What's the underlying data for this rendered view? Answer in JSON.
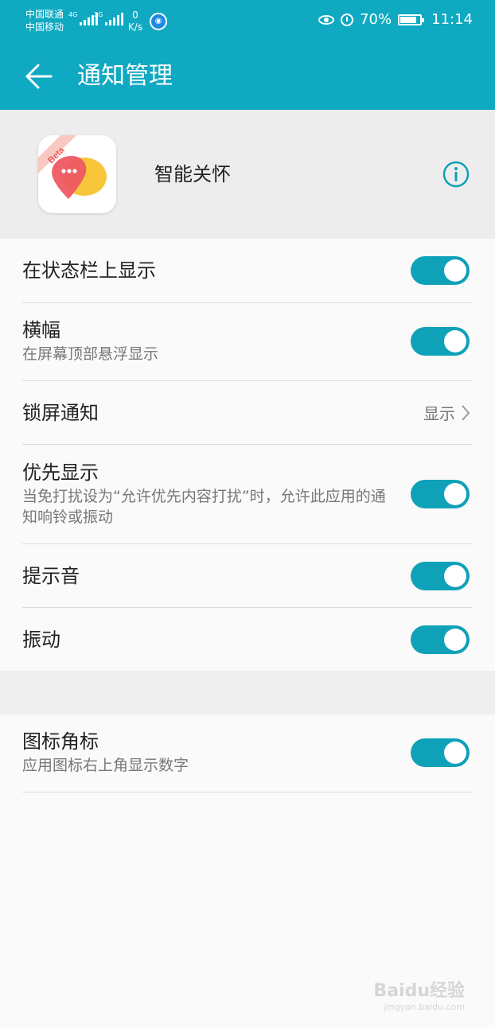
{
  "status_bar": {
    "carrier1": "中国联通",
    "carrier2": "中国移动",
    "net1": "4G",
    "net2": "2G",
    "speed_value": "0",
    "speed_unit": "K/s",
    "battery": "70%",
    "battery_level": 0.7,
    "time": "11:14"
  },
  "header": {
    "title": "通知管理"
  },
  "app": {
    "name": "智能关怀",
    "badge": "Beta"
  },
  "settings": [
    {
      "title": "在状态栏上显示",
      "subtitle": "",
      "type": "toggle",
      "on": true
    },
    {
      "title": "横幅",
      "subtitle": "在屏幕顶部悬浮显示",
      "type": "toggle",
      "on": true
    },
    {
      "title": "锁屏通知",
      "subtitle": "",
      "type": "value",
      "value": "显示"
    },
    {
      "title": "优先显示",
      "subtitle": "当免打扰设为“允许优先内容打扰”时，允许此应用的通知响铃或振动",
      "type": "toggle",
      "on": true
    },
    {
      "title": "提示音",
      "subtitle": "",
      "type": "toggle",
      "on": true
    },
    {
      "title": "振动",
      "subtitle": "",
      "type": "toggle",
      "on": true
    },
    {
      "title": "图标角标",
      "subtitle": "应用图标右上角显示数字",
      "type": "toggle",
      "on": true
    }
  ],
  "watermark": {
    "brand": "Baidu经验",
    "url": "jingyan.baidu.com"
  },
  "colors": {
    "accent": "#0fa9c2",
    "toggle_on": "#0fa1b8"
  }
}
